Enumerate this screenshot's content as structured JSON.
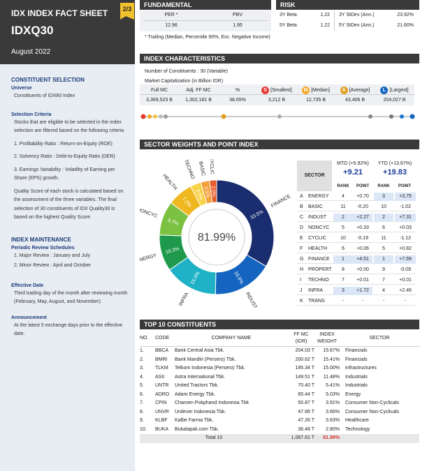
{
  "header": {
    "title": "IDX INDEX FACT SHEET",
    "code": "IDXQ30",
    "date": "August 2022",
    "page": "2/3"
  },
  "sidebar": {
    "constituent_selection": {
      "title": "CONSTITUENT SELECTION",
      "universe_label": "Universe",
      "universe_text": "Constituents of IDX80 Index",
      "criteria_label": "Selection Criteria",
      "criteria_intro": "Stocks that are eligible to be selected in the index selection are filtered based on the following criteria",
      "criteria": [
        "1.  Profitability Ratio : Return-on-Equity (ROE)",
        "2.  Solvency Ratio : Debt-to-Equity Ratio (DER)",
        "3.  Earnings Variability : Volatility of Earning per Share (EPS) growth."
      ],
      "quality_text": "Quality Score of each stock is calculated based on the assessment of the three variables. The final selection of 30 constituents of IDX Quality30 is based on the highest Quality Score"
    },
    "maintenance": {
      "title": "INDEX MAINTENANCE",
      "periodic_label": "Periodic Review Schedules",
      "reviews": [
        "1.  Major Review :  January and July",
        "2.  Minor Review :  April and October"
      ]
    },
    "effective": {
      "label": "Effective Date",
      "text": "Third trading day of the month after reviewing month (February, May, August, and November)."
    },
    "announcement": {
      "label": "Announcement",
      "text": "At the latest 5 exchange days prior to the effective date."
    }
  },
  "fundamental": {
    "title": "FUNDAMENTAL",
    "per_label": "PER *",
    "per": "12.96",
    "pbv_label": "PBV",
    "pbv": "1.95",
    "note": "* Trailing (Median, Percentile 90%, Exc. Negative Income)"
  },
  "risk": {
    "title": "RISK",
    "beta3_label": "3Y Beta",
    "beta3": "1.22",
    "beta5_label": "5Y Beta",
    "beta5": "1.22",
    "sd3_label": "3Y StDev (Ann.)",
    "sd3": "23.92%",
    "sd5_label": "5Y StDev (Ann.)",
    "sd5": "21.60%"
  },
  "index_char": {
    "title": "INDEX CHARACTERISTICS",
    "constituents": "Number of Constituents : 30 (Variable)",
    "mcap": "Market Capitalization (in Billion IDR)",
    "headers": [
      "Full MC",
      "Adj. FF MC",
      "%",
      "[Smallest]",
      "[Median]",
      "[Average]",
      "[Largest]"
    ],
    "values": [
      "3,369,523 B",
      "1,302,181 B",
      "38.65%",
      "3,212 B",
      "12,735 B",
      "43,406 B",
      "204,027 B"
    ],
    "badges": [
      {
        "letter": "S",
        "color": "#e53935"
      },
      {
        "letter": "M",
        "color": "#f5a623"
      },
      {
        "letter": "A",
        "color": "#e0a020"
      },
      {
        "letter": "L",
        "color": "#1565c0"
      }
    ]
  },
  "sector_weights": {
    "title": "SECTOR WEIGHTS AND POINT INDEX",
    "center_label": "81.99%",
    "header": {
      "sector": "SECTOR",
      "mtd": "MTD (+5.92%)",
      "mtd_val": "+9.21",
      "ytd": "YTD (+13.67%)",
      "ytd_val": "+19.83",
      "rank": "RANK",
      "point": "POINT"
    },
    "rows": [
      {
        "letter": "A",
        "name": "ENERGY",
        "mtd_rank": "4",
        "mtd_point": "+0.70",
        "ytd_rank": "3",
        "ytd_point": "+3.75"
      },
      {
        "letter": "B",
        "name": "BASIC",
        "mtd_rank": "11",
        "mtd_point": "-0.20",
        "ytd_rank": "10",
        "ytd_point": "-1.02"
      },
      {
        "letter": "C",
        "name": "INDUST",
        "mtd_rank": "2",
        "mtd_point": "+2.27",
        "ytd_rank": "2",
        "ytd_point": "+7.31"
      },
      {
        "letter": "D",
        "name": "NONCYC",
        "mtd_rank": "5",
        "mtd_point": "+0.33",
        "ytd_rank": "6",
        "ytd_point": "+0.03"
      },
      {
        "letter": "E",
        "name": "CYCLIC",
        "mtd_rank": "10",
        "mtd_point": "-0.19",
        "ytd_rank": "11",
        "ytd_point": "-1.12"
      },
      {
        "letter": "F",
        "name": "HEALTH",
        "mtd_rank": "6",
        "mtd_point": "+0.06",
        "ytd_rank": "5",
        "ytd_point": "+0.82"
      },
      {
        "letter": "G",
        "name": "FINANCE",
        "mtd_rank": "1",
        "mtd_point": "+4.51",
        "ytd_rank": "1",
        "ytd_point": "+7.69"
      },
      {
        "letter": "H",
        "name": "PROPERT",
        "mtd_rank": "8",
        "mtd_point": "+0.00",
        "ytd_rank": "9",
        "ytd_point": "-0.09"
      },
      {
        "letter": "I",
        "name": "TECHNO",
        "mtd_rank": "7",
        "mtd_point": "+0.01",
        "ytd_rank": "7",
        "ytd_point": "+0.01"
      },
      {
        "letter": "J",
        "name": "INFRA",
        "mtd_rank": "3",
        "mtd_point": "+1.72",
        "ytd_rank": "4",
        "ytd_point": "+2.46"
      },
      {
        "letter": "K",
        "name": "TRANS",
        "mtd_rank": "-",
        "mtd_point": "-",
        "ytd_rank": "-",
        "ytd_point": "-"
      }
    ],
    "highlight_color": "#dbe7f6"
  },
  "chart_data": {
    "type": "pie",
    "categories": [
      "FINANCE",
      "INDUST",
      "INFRA",
      "ENERGY",
      "NONCYC",
      "HEALTH",
      "TECHNO",
      "BASIC",
      "CYCLIC"
    ],
    "values": [
      33.5,
      16.9,
      15.0,
      10.3,
      9.7,
      7.2,
      3.0,
      2.5,
      2.0
    ],
    "labels": [
      "33.5%",
      "16.9%",
      "15.0%",
      "10.3%",
      "9.7%",
      "7.2%",
      "3.0%",
      "2.5%",
      "2.0%"
    ],
    "colors": [
      "#1a2d6e",
      "#1565c0",
      "#1fb2c6",
      "#1f9a4c",
      "#7cc242",
      "#f0b820",
      "#f7d24a",
      "#f4a03a",
      "#e85a2a"
    ],
    "center_label": "81.99%"
  },
  "top10": {
    "title": "TOP 10 CONSTITUENTS",
    "headers": {
      "no": "NO.",
      "code": "CODE",
      "company": "COMPANY NAME",
      "ffmc": "FF MC",
      "ffmc_unit": "(IDR)",
      "weight": "INDEX",
      "weight2": "WEIGHT",
      "sector": "SECTOR"
    },
    "rows": [
      {
        "no": "1.",
        "code": "BBCA",
        "company": "Bank Central Asia Tbk.",
        "ffmc": "204.03 T",
        "weight": "15.67%",
        "sector": "Financials"
      },
      {
        "no": "2.",
        "code": "BMRI",
        "company": "Bank Mandiri (Persero) Tbk.",
        "ffmc": "200.62 T",
        "weight": "15.41%",
        "sector": "Financials"
      },
      {
        "no": "3.",
        "code": "TLKM",
        "company": "Telkom Indonesia (Persero) Tbk.",
        "ffmc": "195.34 T",
        "weight": "15.00%",
        "sector": "Infrastructures"
      },
      {
        "no": "4.",
        "code": "ASII",
        "company": "Astra International Tbk.",
        "ffmc": "149.51 T",
        "weight": "11.48%",
        "sector": "Industrials"
      },
      {
        "no": "5.",
        "code": "UNTR",
        "company": "United Tractors Tbk.",
        "ffmc": "70.40 T",
        "weight": "5.41%",
        "sector": "Industrials"
      },
      {
        "no": "6.",
        "code": "ADRO",
        "company": "Adaro Energy Tbk.",
        "ffmc": "65.44 T",
        "weight": "5.03%",
        "sector": "Energy"
      },
      {
        "no": "7.",
        "code": "CPIN",
        "company": "Charoen Pokphand Indonesia Tbk",
        "ffmc": "50.87 T",
        "weight": "3.91%",
        "sector": "Consumer Non-Cyclicals"
      },
      {
        "no": "8.",
        "code": "UNVR",
        "company": "Unilever Indonesia Tbk.",
        "ffmc": "47.66 T",
        "weight": "3.66%",
        "sector": "Consumer Non-Cyclicals"
      },
      {
        "no": "9.",
        "code": "KLBF",
        "company": "Kalbe Farma Tbk.",
        "ffmc": "47.26 T",
        "weight": "3.63%",
        "sector": "Healthcare"
      },
      {
        "no": "10.",
        "code": "BUKA",
        "company": "Bukalapak.com Tbk.",
        "ffmc": "36.48 T",
        "weight": "2.80%",
        "sector": "Technology"
      }
    ],
    "total_label": "Total 10",
    "total_ffmc": "1,067.61 T",
    "total_weight": "81.99%"
  }
}
